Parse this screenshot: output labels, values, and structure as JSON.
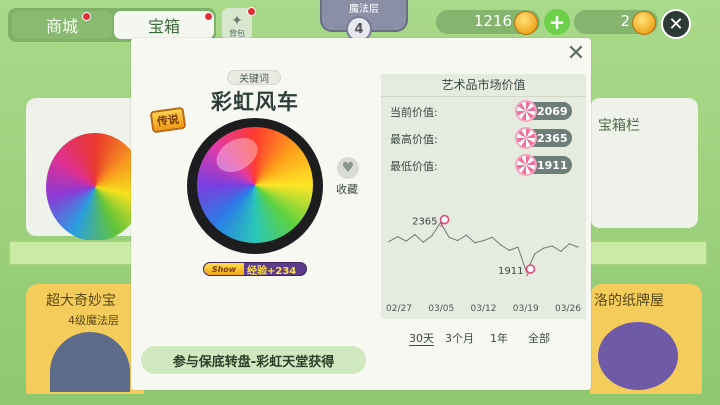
{
  "header": {
    "tabs": [
      {
        "label": "商城",
        "has_dot": true
      },
      {
        "label": "宝箱",
        "has_dot": true
      }
    ],
    "bag_label": "背包",
    "layer_label": "魔法层",
    "layer_number": "4",
    "currency_gold": "1216",
    "currency_other": "2",
    "plus_icon": "plus-icon",
    "close_icon": "close-icon"
  },
  "background": {
    "right_card_label": "宝箱栏",
    "bottom_left_title": "超大奇妙宝",
    "bottom_left_subtitle": "4级魔法层",
    "bottom_right_title": "洛的纸牌屋"
  },
  "item": {
    "keyword_tag": "关键词",
    "name": "彩虹风车",
    "rarity": "传说",
    "favorite_label": "收藏",
    "show_tag": "Show",
    "exp_label": "经验+234",
    "source_button": "参与保底转盘-彩虹天堂获得"
  },
  "market": {
    "title": "艺术品市场价值",
    "rows": [
      {
        "label": "当前价值:",
        "value": "2069"
      },
      {
        "label": "最高价值:",
        "value": "2365"
      },
      {
        "label": "最低价值:",
        "value": "1911"
      }
    ],
    "range_tabs": [
      "30天",
      "3个月",
      "1年",
      "全部"
    ],
    "active_range": "30天"
  },
  "chart_data": {
    "type": "line",
    "x_ticks": [
      "02/27",
      "03/05",
      "03/12",
      "03/19",
      "03/26"
    ],
    "series": [
      {
        "values": [
          2190,
          2235,
          2195,
          2255,
          2185,
          2245,
          2365,
          2230,
          2200,
          2250,
          2180,
          2200,
          2230,
          2160,
          2110,
          2140,
          1911,
          2080,
          2130,
          2150,
          2100,
          2170,
          2140
        ]
      }
    ],
    "annotations": [
      {
        "label": "2365",
        "index": 6
      },
      {
        "label": "1911",
        "index": 16
      }
    ],
    "ylim": [
      1700,
      2600
    ],
    "grid": false
  }
}
